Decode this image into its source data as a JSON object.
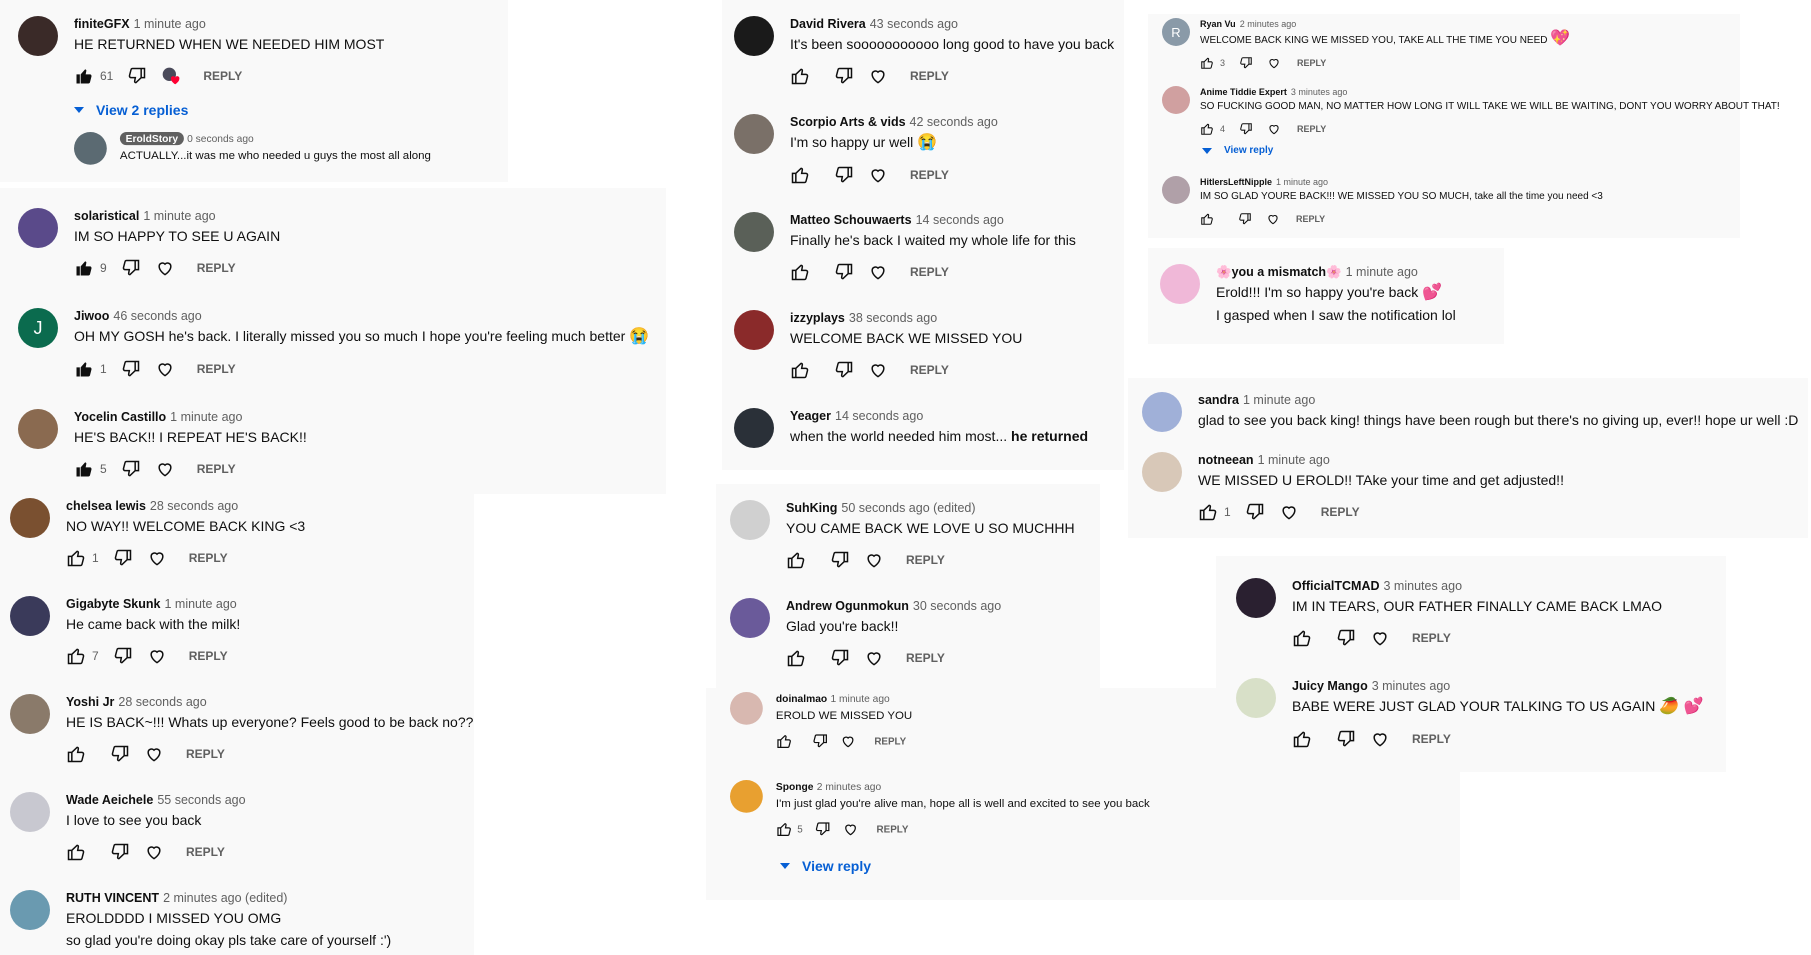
{
  "colors": {
    "panel": "#f9f9f9",
    "link": "#065fd4",
    "muted": "#606060",
    "heart": "#ff0033"
  },
  "labels": {
    "reply": "REPLY"
  },
  "col1": [
    {
      "author": "finiteGFX",
      "time": "1 minute ago",
      "text": "HE RETURNED WHEN WE NEEDED HIM MOST",
      "likes": "61",
      "avatar": "#3a2a28"
    },
    {
      "view": "View 2 replies"
    },
    {
      "author": "EroldStory",
      "time": "0 seconds ago",
      "text": "ACTUALLY...it was me who needed u guys the most all along",
      "avatar": "#5b6a72"
    },
    {
      "author": "solaristical",
      "time": "1 minute ago",
      "text": "IM SO HAPPY TO SEE U AGAIN",
      "likes": "9",
      "avatar": "#5a4a8a"
    },
    {
      "author": "Jiwoo",
      "time": "46 seconds ago",
      "text": "OH MY GOSH he's back. I literally missed you so much I hope you're feeling much better",
      "emoji": "😭",
      "likes": "1",
      "avatar": "#0b6b4e",
      "initial": "J"
    },
    {
      "author": "Yocelin Castillo",
      "time": "1 minute ago",
      "text": "HE'S BACK!! I REPEAT HE'S BACK!!",
      "likes": "5",
      "avatar": "#8a6a50"
    },
    {
      "author": "chelsea lewis",
      "time": "28 seconds ago",
      "text": "NO WAY!! WELCOME BACK KING <3",
      "likes": "1",
      "avatar": "#7a5030"
    },
    {
      "author": "Gigabyte Skunk",
      "time": "1 minute ago",
      "text": "He came back with the milk!",
      "likes": "7",
      "avatar": "#3a3a5a"
    },
    {
      "author": "Yoshi Jr",
      "time": "28 seconds ago",
      "text": "HE IS BACK~!!! Whats up everyone? Feels good to be back no??",
      "likes": "",
      "avatar": "#8a7a6a"
    },
    {
      "author": "Wade Aeichele",
      "time": "55 seconds ago",
      "text": "I love to see you back",
      "likes": "",
      "avatar": "#c8c8d0"
    },
    {
      "author": "RUTH VINCENT",
      "time": "2 minutes ago (edited)",
      "text": "EROLDDDD I MISSED YOU OMG",
      "text2": "so glad you're doing okay pls take care of yourself :')",
      "avatar": "#6a9ab0"
    }
  ],
  "col2": [
    {
      "author": "David Rivera",
      "time": "43 seconds ago",
      "text": "It's been sooooooooooo long good to have you back",
      "avatar": "#1a1a1a"
    },
    {
      "author": "Scorpio Arts & vids",
      "time": "42 seconds ago",
      "text": "I'm so happy ur well",
      "emoji": "😭",
      "avatar": "#7a7068"
    },
    {
      "author": "Matteo Schouwaerts",
      "time": "14 seconds ago",
      "text": "Finally he's back I waited my whole life for this",
      "avatar": "#5a6058"
    },
    {
      "author": "izzyplays",
      "time": "38 seconds ago",
      "text": "WELCOME BACK WE MISSED YOU",
      "avatar": "#8a2a2a"
    },
    {
      "author": "Yeager",
      "time": "14 seconds ago",
      "text": "when the world needed him most...",
      "bold": "he returned",
      "avatar": "#2a3038"
    },
    {
      "author": "SuhKing",
      "time": "50 seconds ago (edited)",
      "text": "YOU CAME BACK WE LOVE U SO MUCHHH",
      "avatar": "#d0d0d0"
    },
    {
      "author": "Andrew Ogunmokun",
      "time": "30 seconds ago",
      "text": "Glad you're back!!",
      "avatar": "#6a5a9a"
    },
    {
      "author": "doinalmao",
      "time": "1 minute ago",
      "text": "EROLD WE MISSED YOU",
      "avatar": "#d8b8b0"
    },
    {
      "author": "Sponge",
      "time": "2 minutes ago",
      "text": "I'm just glad you're alive man, hope all is well and excited to see you back",
      "likes": "5",
      "avatar": "#e8a030"
    },
    {
      "view": "View reply"
    }
  ],
  "col3": [
    {
      "author": "Ryan Vu",
      "time": "2 minutes ago",
      "text": "WELCOME BACK KING WE MISSED YOU, TAKE ALL THE TIME YOU NEED",
      "emoji": "💖",
      "likes": "3",
      "avatar": "#8a9aa8",
      "initial": "R"
    },
    {
      "author": "Anime Tiddie Expert",
      "time": "3 minutes ago",
      "text": "SO FUCKING GOOD MAN, NO MATTER HOW LONG IT WILL TAKE WE WILL BE WAITING, DONT YOU WORRY ABOUT THAT!",
      "likes": "4",
      "avatar": "#d0a0a0"
    },
    {
      "view": "View reply"
    },
    {
      "author": "HitlersLeftNipple",
      "time": "1 minute ago",
      "text": "IM SO GLAD YOURE BACK!!! WE MISSED YOU SO MUCH, take all the time you need <3",
      "avatar": "#b0a0a8"
    },
    {
      "author": "🌸you a mismatch🌸",
      "time": "1 minute ago",
      "text": "Erold!!! I'm so happy you're back",
      "emoji": "💕",
      "text2": "I gasped when I saw the notification lol",
      "avatar": "#f0b8d8"
    },
    {
      "author": "sandra",
      "time": "1 minute ago",
      "text": "glad to see you back king! things have been rough but there's no giving up, ever!! hope ur well :D",
      "avatar": "#a0b0d8"
    },
    {
      "author": "notneean",
      "time": "1 minute ago",
      "text": "WE MISSED U EROLD!! TAke your time and get adjusted!!",
      "likes": "1",
      "avatar": "#d8c8b8"
    },
    {
      "author": "OfficialTCMAD",
      "time": "3 minutes ago",
      "text": "IM IN TEARS, OUR FATHER FINALLY CAME BACK LMAO",
      "avatar": "#2a2030"
    },
    {
      "author": "Juicy Mango",
      "time": "3 minutes ago",
      "text": "BABE WERE JUST GLAD YOUR TALKING TO US AGAIN",
      "emoji": "🥭 💕",
      "avatar": "#d8e0c8"
    }
  ]
}
